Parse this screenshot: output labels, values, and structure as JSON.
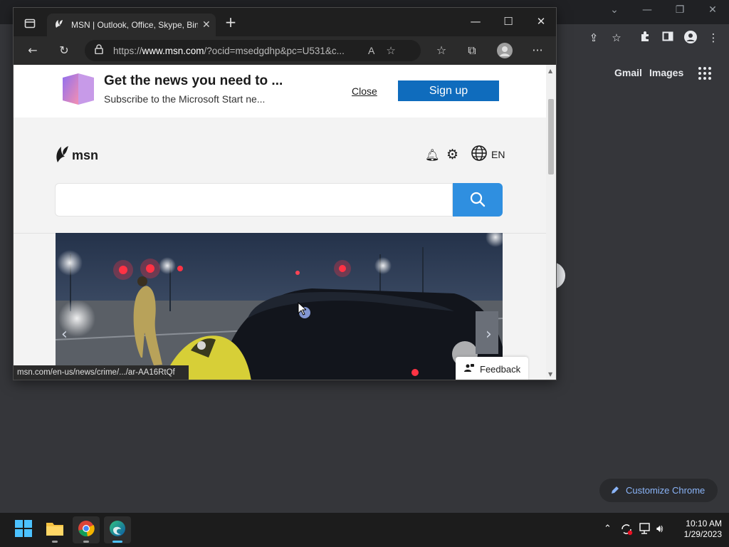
{
  "chrome_bg": {
    "window_controls": [
      "⌄",
      "—",
      "❐",
      "✕"
    ],
    "toolbar_icons": [
      "share-icon",
      "star-icon",
      "extensions-icon",
      "sidebar-icon",
      "profile-icon",
      "menu-icon"
    ],
    "links": [
      "Gmail",
      "Images"
    ],
    "customize_label": "Customize Chrome"
  },
  "edge": {
    "tab_title": "MSN | Outlook, Office, Skype, Bing",
    "url_prefix": "https://",
    "url_host": "www.msn.com",
    "url_rest": "/?ocid=msedgdhp&pc=U531&c...",
    "status_link": "msn.com/en-us/news/crime/.../ar-AA16RtQf"
  },
  "page": {
    "banner": {
      "title": "Get the news you need to ...",
      "subtitle": "Subscribe to the Microsoft Start ne...",
      "close_label": "Close",
      "signup_label": "Sign up"
    },
    "logo_text": "msn",
    "language": "EN",
    "search_placeholder": "",
    "feedback_label": "Feedback"
  },
  "taskbar": {
    "apps": [
      "start",
      "file-explorer",
      "chrome",
      "edge"
    ],
    "time": "10:10 AM",
    "date": "1/29/2023"
  },
  "colors": {
    "accent_blue": "#0f6cbd",
    "search_blue": "#2f8fe0",
    "chrome_link": "#8ab4f8",
    "taskbar_active": "#4cc2ff"
  }
}
